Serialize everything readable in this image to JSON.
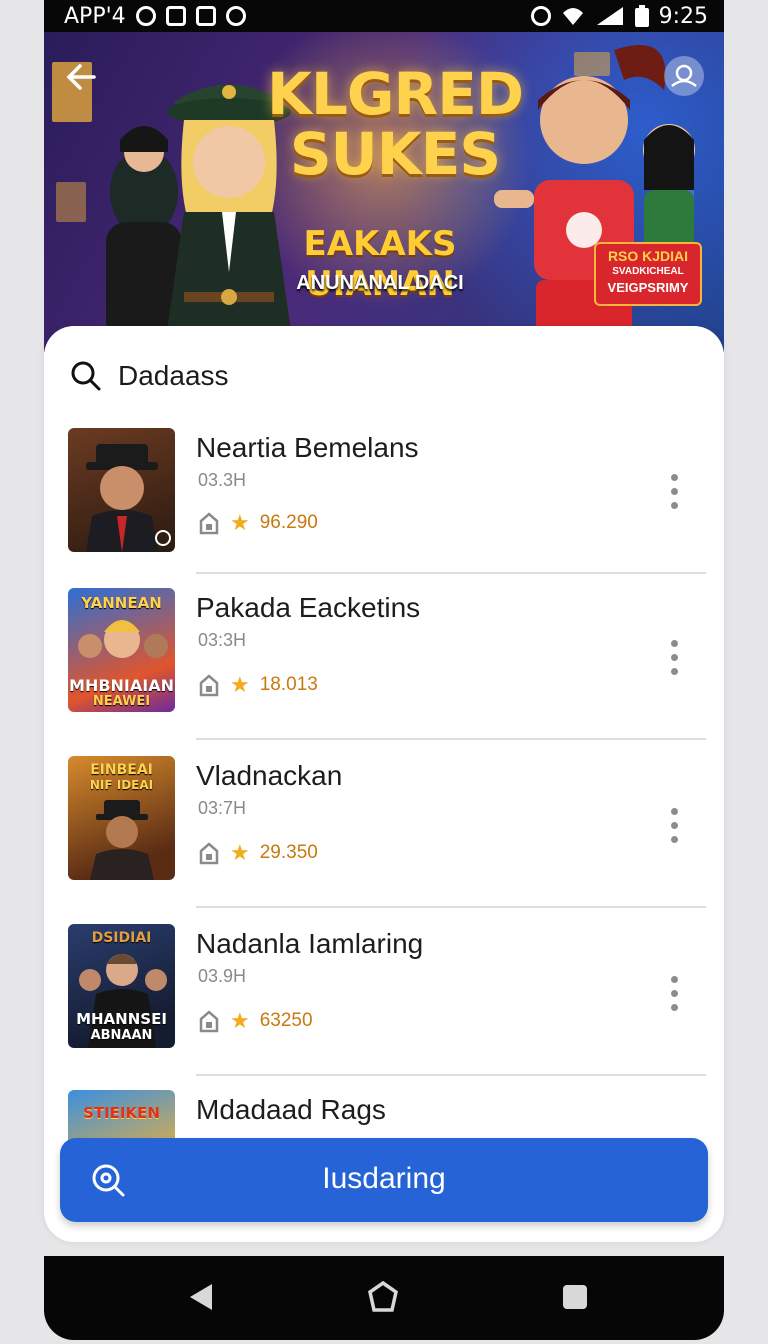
{
  "status_bar": {
    "app": "APP'4",
    "time": "9:25"
  },
  "banner": {
    "title_line1": "KLGRED",
    "title_line2": "SUKES",
    "subtitle": "EAKAKS UIANAN",
    "caption": "ANUNANAL DACI",
    "badge_line1": "RSO KJDIAI",
    "badge_line2": "SVADKICHEAL",
    "badge_line3": "VEIGPSRIMY"
  },
  "search": {
    "label": "Dadaass"
  },
  "list": {
    "items": [
      {
        "title": "Neartia Bemelans",
        "meta": "03.3H",
        "rating": "96.290",
        "thumb_text": ""
      },
      {
        "title": "Pakada Eacketins",
        "meta": "03:3H",
        "rating": "18.013",
        "thumb_text": "YANNEAN"
      },
      {
        "title": "Vladnackan",
        "meta": "03:7H",
        "rating": "29.350",
        "thumb_text": "EINBEAI"
      },
      {
        "title": "Nadanla Iamlaring",
        "meta": "03.9H",
        "rating": "63250",
        "thumb_text": "DSIDIAI"
      },
      {
        "title": "Mdadaad Rags",
        "meta": "",
        "rating": "",
        "thumb_text": "STIEIKEN"
      }
    ]
  },
  "thumb_extra": {
    "t2_line1": "MHBNIAIAN",
    "t2_line2": "NEAWEI",
    "t3_line2": "NIF IDEAI",
    "t4_line1": "MHANNSEI",
    "t4_line2": "ABNAAN"
  },
  "cta": {
    "label": "Iusdaring"
  },
  "colors": {
    "accent": "#2563d6",
    "star": "#f3ab1a",
    "rating_text": "#c9790d"
  }
}
